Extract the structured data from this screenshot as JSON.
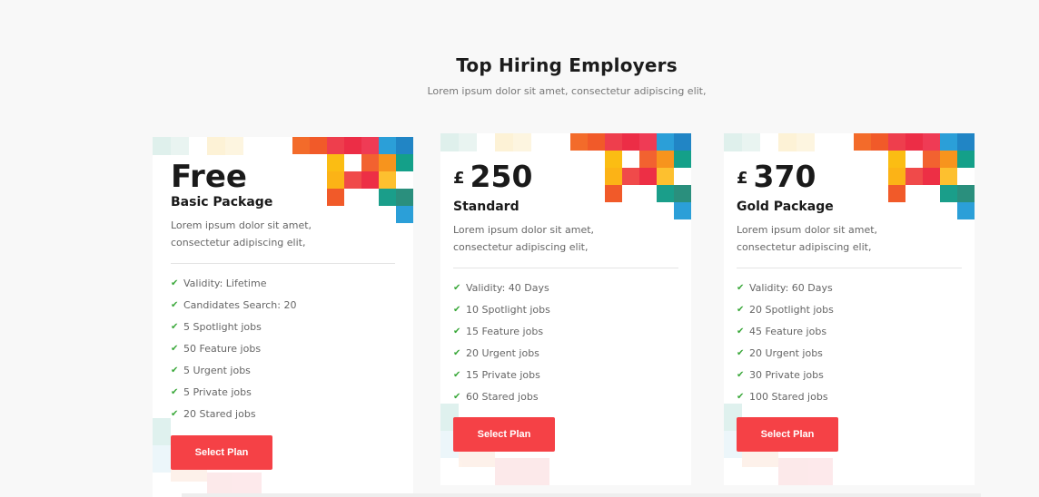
{
  "section": {
    "title": "Top Hiring Employers",
    "subtitle": "Lorem ipsum dolor sit amet, consectetur adipiscing elit,"
  },
  "plans": [
    {
      "price": "Free",
      "currency": "",
      "name": "Basic Package",
      "description": "Lorem ipsum dolor sit amet, consectetur adipiscing elit,",
      "features": [
        "Validity: Lifetime",
        "Candidates Search: 20",
        "5 Spotlight jobs",
        "50 Feature jobs",
        "5 Urgent jobs",
        "5 Private jobs",
        "20 Stared jobs"
      ],
      "button_label": "Select Plan"
    },
    {
      "price": "250",
      "currency": "£",
      "name": "Standard",
      "description": "Lorem ipsum dolor sit amet, consectetur adipiscing elit,",
      "features": [
        "Validity: 40 Days",
        "10 Spotlight jobs",
        "15 Feature jobs",
        "20 Urgent jobs",
        "15 Private jobs",
        "60 Stared jobs"
      ],
      "button_label": "Select Plan"
    },
    {
      "price": "370",
      "currency": "£",
      "name": "Gold Package",
      "description": "Lorem ipsum dolor sit amet, consectetur adipiscing elit,",
      "features": [
        "Validity: 60 Days",
        "20 Spotlight jobs",
        "45 Feature jobs",
        "20 Urgent jobs",
        "30 Private jobs",
        "100 Stared jobs"
      ],
      "button_label": "Select Plan"
    }
  ],
  "colors": {
    "accent": "#f54146",
    "check": "#3aa83a",
    "background": "#f8f8f8"
  },
  "icons": {
    "feature_bullet": "check-icon"
  }
}
